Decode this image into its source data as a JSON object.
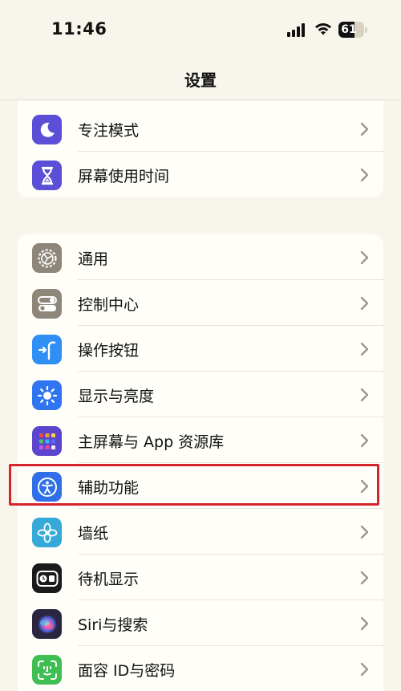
{
  "status_bar": {
    "time": "11:46",
    "battery_level": "61",
    "battery_fraction": 0.61
  },
  "nav": {
    "title": "设置"
  },
  "groups": [
    {
      "items": [
        {
          "label": "专注模式",
          "icon": "moon-icon",
          "color": "#5a4fd6"
        },
        {
          "label": "屏幕使用时间",
          "icon": "hourglass-icon",
          "color": "#5a4fd6"
        }
      ]
    },
    {
      "items": [
        {
          "label": "通用",
          "icon": "gear-icon",
          "color": "#8e8679"
        },
        {
          "label": "控制中心",
          "icon": "toggles-icon",
          "color": "#8e8679"
        },
        {
          "label": "操作按钮",
          "icon": "action-button-icon",
          "color": "#2f8ff5"
        },
        {
          "label": "显示与亮度",
          "icon": "sun-icon",
          "color": "#2f74f0"
        },
        {
          "label": "主屏幕与 App 资源库",
          "icon": "app-grid-icon",
          "color": "#5b45cf"
        },
        {
          "label": "辅助功能",
          "icon": "accessibility-icon",
          "color": "#2f70e8"
        },
        {
          "label": "墙纸",
          "icon": "flower-icon",
          "color": "#35a9d8"
        },
        {
          "label": "待机显示",
          "icon": "standby-icon",
          "color": "#1a1a1a"
        },
        {
          "label": "Siri与搜索",
          "icon": "siri-icon",
          "color": "#2b2540"
        },
        {
          "label": "面容 ID与密码",
          "icon": "face-id-icon",
          "color": "#3fbf52"
        }
      ]
    }
  ],
  "highlighted_item": "辅助功能",
  "colors": {
    "background": "#f8f6ec",
    "card": "#fffef9",
    "highlight": "#d7232b"
  }
}
